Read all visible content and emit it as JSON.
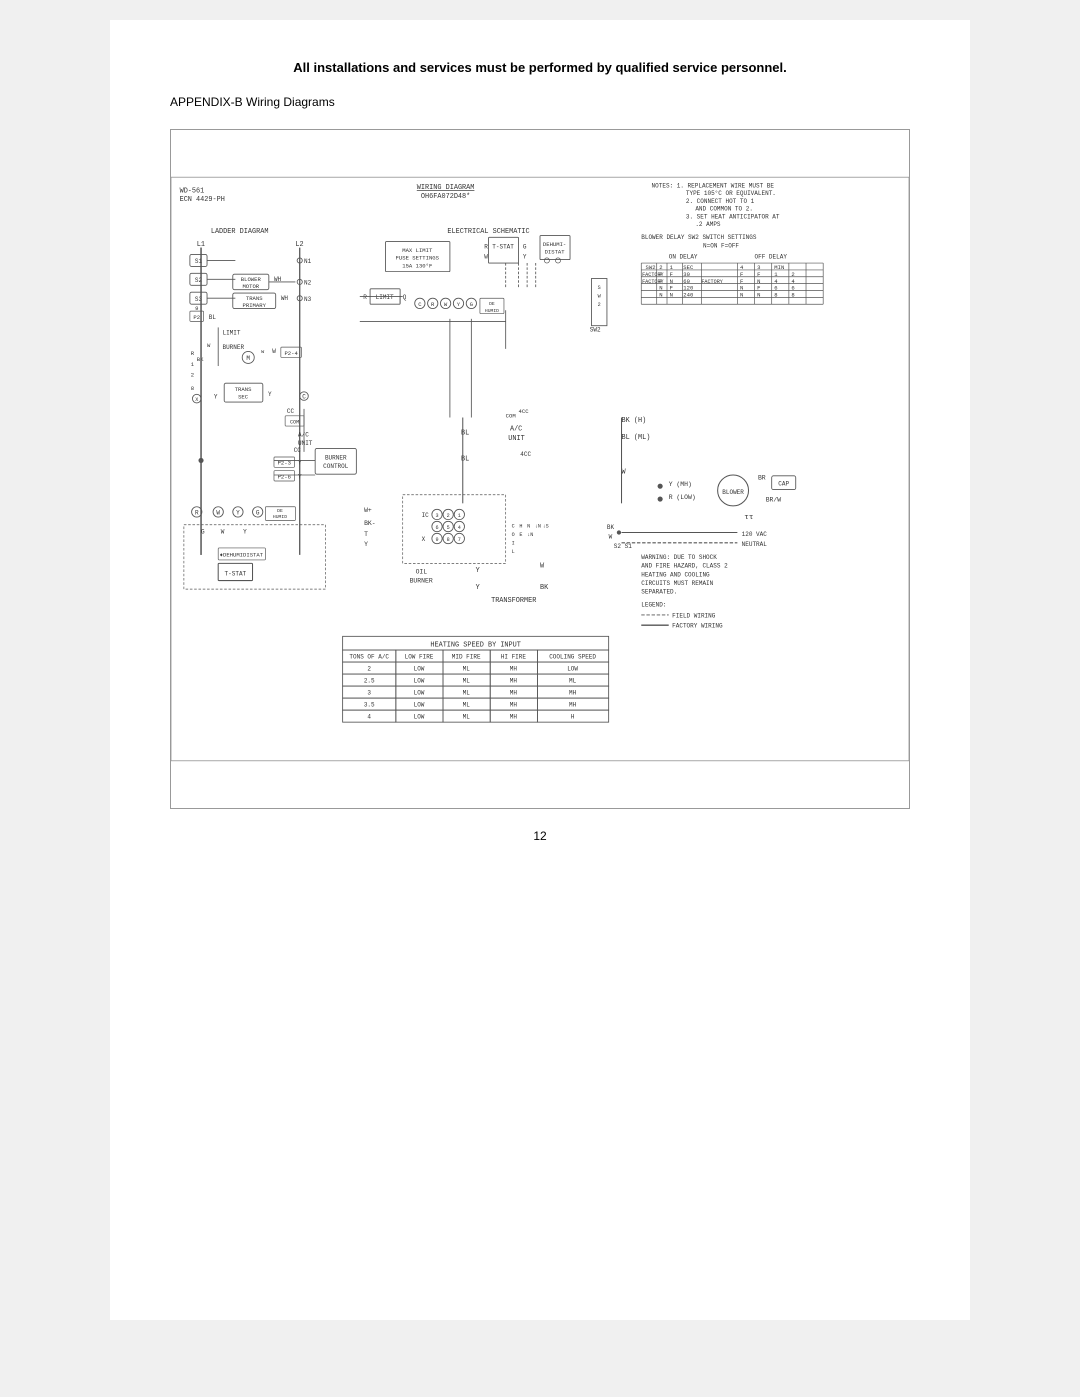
{
  "page": {
    "header": "All installations and services must be performed by qualified service personnel.",
    "appendix_title": "APPENDIX-B Wiring Diagrams",
    "page_number": "12",
    "diagram": {
      "wd_label": "WD-561",
      "ecn_label": "ECN 4429-PH",
      "wiring_diagram_label": "WIRING DIAGRAM",
      "wiring_diagram_code": "OH6FA072D48*",
      "notes_title": "NOTES:",
      "notes": [
        "1. REPLACEMENT WIRE MUST BE TYPE 105°C OR EQUIVALENT.",
        "2. CONNECT HOT TO 1 AND COMMON TO 2.",
        "3. SET HEAT ANTICIPATOR AT .2 AMPS"
      ],
      "ladder_diagram_label": "LADDER DIAGRAM",
      "electrical_schematic_label": "ELECTRICAL SCHEMATIC",
      "burner_control_label": "BURNER CONTROL",
      "oil_burner_label": "OIL BURNER",
      "transformer_label": "TRANSFORMER",
      "blower_delay_label": "BLOWER DELAY SW2 SWITCH SETTINGS",
      "n_on_label": "N=ON F=OFF",
      "heating_speed_label": "HEATING SPEED BY INPUT",
      "legend_field_wiring": "FIELD WIRING",
      "legend_factory_wiring": "FACTORY WIRING",
      "heating_table": {
        "header_row": [
          "TONS OF A/C",
          "LOW FIRE",
          "MID FIRE",
          "HI FIRE",
          "COOLING SPEED"
        ],
        "rows": [
          [
            "2",
            "LOW",
            "ML",
            "MH",
            "LOW"
          ],
          [
            "2.5",
            "LOW",
            "ML",
            "MH",
            "ML"
          ],
          [
            "3",
            "LOW",
            "ML",
            "MH",
            "MH"
          ],
          [
            "3.5",
            "LOW",
            "ML",
            "MH",
            "MH"
          ],
          [
            "4",
            "LOW",
            "ML",
            "MH",
            "H"
          ]
        ]
      }
    }
  }
}
